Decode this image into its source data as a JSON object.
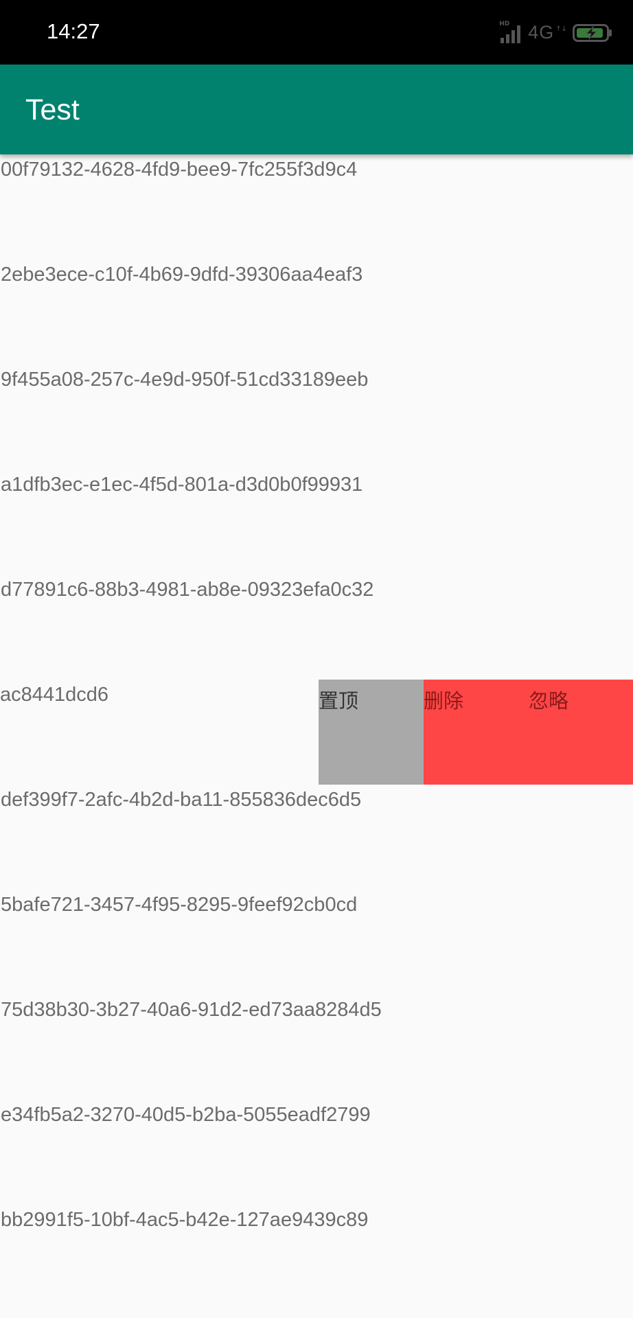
{
  "status_bar": {
    "time": "14:27",
    "network_label": "4G",
    "signal_badge": "HD",
    "icons": [
      "signal-icon",
      "battery-charging-icon"
    ]
  },
  "app_bar": {
    "title": "Test",
    "background_color": "#00826f"
  },
  "list": {
    "items": [
      "00f79132-4628-4fd9-bee9-7fc255f3d9c4",
      "2ebe3ece-c10f-4b69-9dfd-39306aa4eaf3",
      "9f455a08-257c-4e9d-950f-51cd33189eeb",
      "a1dfb3ec-e1ec-4f5d-801a-d3d0b0f99931",
      "d77891c6-88b3-4981-ab8e-09323efa0c32",
      "ac8441dcd6",
      "def399f7-2afc-4b2d-ba11-855836dec6d5",
      "5bafe721-3457-4f95-8295-9feef92cb0cd",
      "75d38b30-3b27-40a6-91d2-ed73aa8284d5",
      "e34fb5a2-3270-40d5-b2ba-5055eadf2799",
      "bb2991f5-10bf-4ac5-b42e-127ae9439c89"
    ],
    "swiped_item_actions": {
      "pin_label": "置顶",
      "delete_label": "删除",
      "ignore_label": "忽略",
      "pin_color": "#a9a9a9",
      "delete_color": "#ff4646"
    }
  }
}
